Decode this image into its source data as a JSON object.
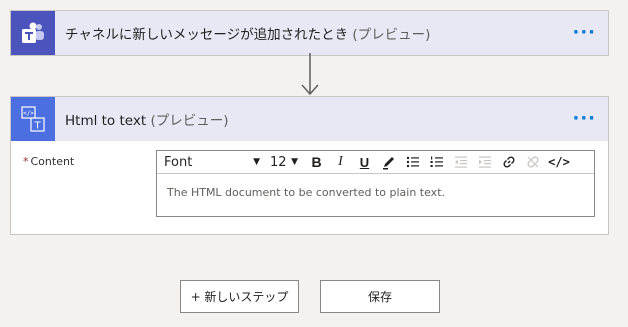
{
  "trigger_card": {
    "title": "チャネルに新しいメッセージが追加されたとき",
    "subtitle": "(プレビュー)",
    "more": "···",
    "icon": "teams-icon"
  },
  "action_card": {
    "title": "Html to text",
    "subtitle": "(プレビュー)",
    "more": "···",
    "icon": "html-to-text-icon",
    "field": {
      "required_marker": "*",
      "label": "Content",
      "placeholder": "The HTML document to be converted to plain text."
    },
    "toolbar": {
      "font": "Font",
      "size": "12",
      "bold": "B",
      "italic": "I",
      "underline": "U",
      "code": "</>"
    }
  },
  "buttons": {
    "new_step": "+ 新しいステップ",
    "save": "保存"
  },
  "colors": {
    "teams": "#4b53bc",
    "html_icon": "#4b6ee0",
    "header_bg": "#e8e8f5",
    "link": "#0078d4"
  }
}
